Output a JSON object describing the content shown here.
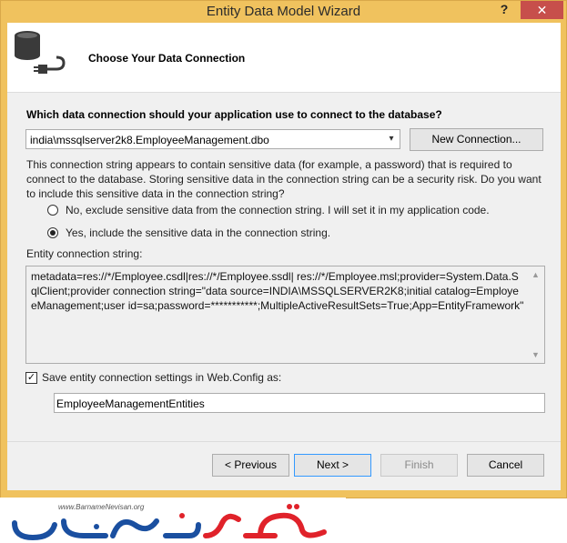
{
  "window": {
    "title": "Entity Data Model Wizard",
    "help_glyph": "?",
    "close_glyph": "✕"
  },
  "header": {
    "title": "Choose Your Data Connection",
    "icon": "database-connection-icon"
  },
  "form": {
    "question": "Which data connection should your application use to connect to the database?",
    "connection_selected": "india\\mssqlserver2k8.EmployeeManagement.dbo",
    "new_connection_label": "New Connection...",
    "warning_text": "This connection string appears to contain sensitive data (for example, a password) that is required to connect to the database. Storing sensitive data in the connection string can be a security risk. Do you want to include this sensitive data in the connection string?",
    "radio_options": [
      {
        "label": "No, exclude sensitive data from the connection string. I will set it in my application code.",
        "selected": false
      },
      {
        "label": "Yes, include the sensitive data in the connection string.",
        "selected": true
      }
    ],
    "entity_connection_label": "Entity connection string:",
    "entity_connection_string": "metadata=res://*/Employee.csdl|res://*/Employee.ssdl|\nres://*/Employee.msl;provider=System.Data.SqlClient;provider connection string=\"data source=INDIA\\MSSQLSERVER2K8;initial catalog=EmployeeManagement;user id=sa;password=***********;MultipleActiveResultSets=True;App=EntityFramework\"",
    "save_checkbox_checked": true,
    "save_checkbox_label": "Save entity connection settings in Web.Config as:",
    "entity_name_value": "EmployeeManagementEntities"
  },
  "buttons": {
    "previous": "< Previous",
    "next": "Next >",
    "finish": "Finish",
    "cancel": "Cancel"
  },
  "watermark": {
    "url": "www.BarnameNevisan.org",
    "logo": "barnamenevisan-logo"
  },
  "colors": {
    "title_bar": "#f0c25e",
    "close_button": "#c74f4b",
    "dialog_bg": "#f0f0f0",
    "header_bg": "#ffffff",
    "logo_red": "#e0222a",
    "logo_blue": "#1a4fa0"
  }
}
